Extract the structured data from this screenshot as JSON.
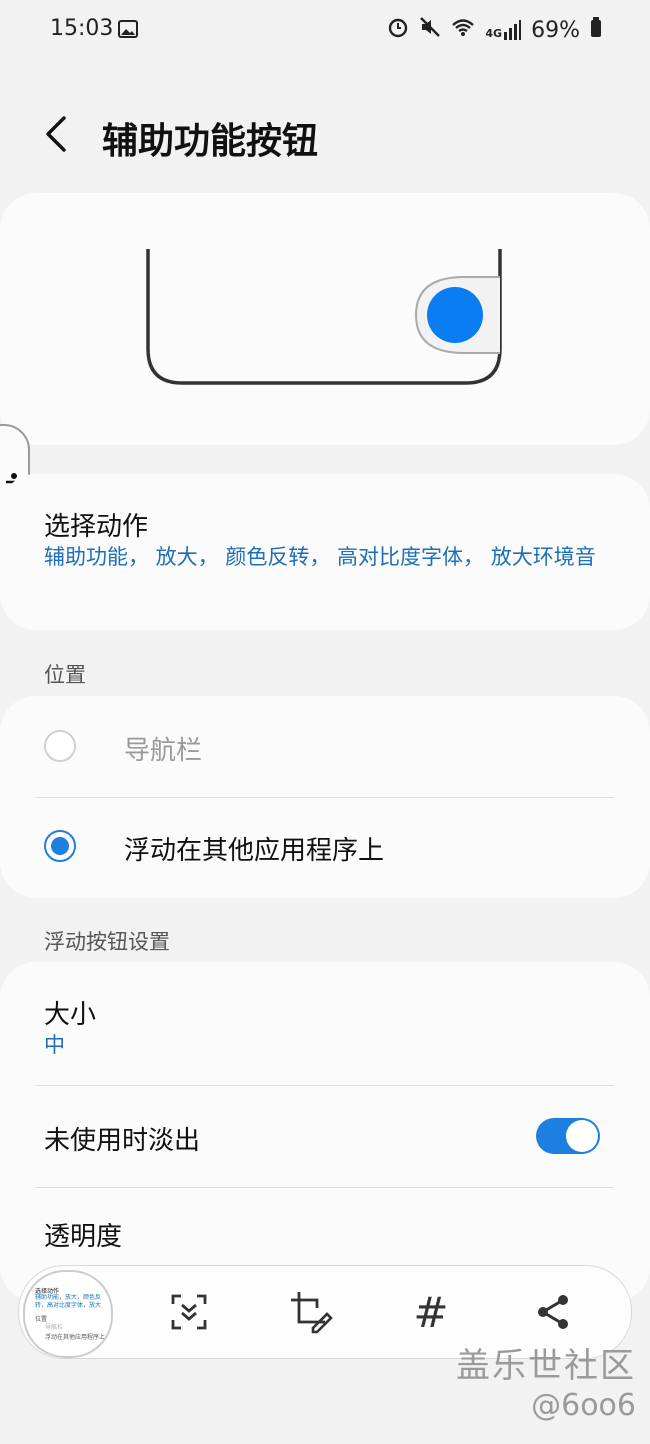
{
  "status": {
    "time": "15:03",
    "battery": "69%",
    "network": "4G"
  },
  "header": {
    "title": "辅助功能按钮"
  },
  "action_card": {
    "title": "选择动作",
    "subtitle": "辅助功能， 放大， 颜色反转， 高对比度字体， 放大环境音"
  },
  "position_section": {
    "label": "位置",
    "options": [
      {
        "label": "导航栏",
        "selected": false
      },
      {
        "label": "浮动在其他应用程序上",
        "selected": true
      }
    ]
  },
  "float_section": {
    "label": "浮动按钮设置",
    "size_title": "大小",
    "size_value": "中",
    "fade_title": "未使用时淡出",
    "fade_on": true,
    "transparency_title": "透明度"
  },
  "toolbar": {
    "thumb_title": "选择动作",
    "thumb_sub": "辅助功能，放大，颜色反转，高对比度字体，放大环境音",
    "thumb_pos": "位置",
    "thumb_opt1": "导航栏",
    "thumb_opt2": "浮动在其他应用程序上",
    "hashtag_glyph": "#"
  },
  "watermark": {
    "brand": "盖乐世社区",
    "handle": "@6oo6"
  },
  "colors": {
    "accent": "#1d7fe0",
    "link": "#1d6fb8",
    "background": "#f2f2f2"
  }
}
